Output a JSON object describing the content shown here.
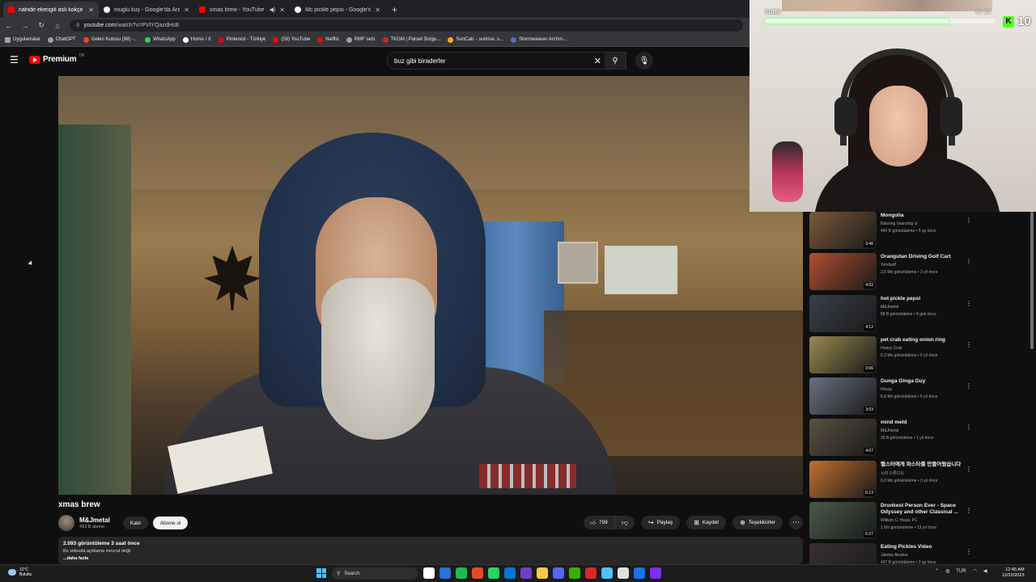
{
  "browser": {
    "tabs": [
      {
        "title": "nahide ekengili asli kokçe - You",
        "favicon": "youtube",
        "active": true
      },
      {
        "title": "muglu kuş - Google'da Ara",
        "favicon": "google",
        "active": false
      },
      {
        "title": "xmas brew - YouTube",
        "favicon": "youtube",
        "active": false
      },
      {
        "title": "Mc pickle pepsi - Google'da Ar",
        "favicon": "google",
        "active": false
      }
    ],
    "url_host": "youtube.com",
    "url_path": "/watch?v=PVtYQazdHsB",
    "bookmarks": [
      "Uygulamalar",
      "ChatGPT",
      "Gelen Kutusu (98) -...",
      "WhatsApp",
      "Home / X",
      "Pinterest - Türkiye",
      "(58) YouTube",
      "Netflix",
      "RMF sets",
      "TKGM | Parsel Sorgu...",
      "SunCalc - sunrise, s...",
      "Stormweaver Archm..."
    ]
  },
  "youtube": {
    "logo_text": "Premium",
    "logo_suffix": "TR",
    "search_query": "buz gibi biraderler"
  },
  "video": {
    "title": "xmas brew",
    "channel": "M&Jmetal",
    "subscribers": "433 B abone",
    "join_label": "Katıl",
    "subscribe_label": "Abone ol",
    "likes": "799",
    "share_label": "Paylaş",
    "save_label": "Kaydet",
    "thanks_label": "Teşekkürler",
    "stats": "2.093 görüntüleme  3 saat önce",
    "description": "Bu videoda açıklama mevcut değil",
    "more_label": "...daha fazla"
  },
  "overlay": {
    "subs_label": "SUBS",
    "subs_progress": "8 / 10",
    "subs_fraction": 0.8,
    "kick_count": "10",
    "kick_color": "#53fc18"
  },
  "recommendations": [
    {
      "title": "Mongolia",
      "channel": "Batzorig Vaanchig ⊘",
      "meta": "440 B görüntüleme • 5 ay önce",
      "duration": "3:46",
      "color": "#7a5a3a"
    },
    {
      "title": "Orangutan Driving Golf Cart",
      "channel": "Tomfoolf",
      "meta": "2,6 Mn görüntüleme • 3 yıl önce",
      "duration": "4:02",
      "color": "#b05030"
    },
    {
      "title": "hot pickle pepsi",
      "channel": "M&Jmetal",
      "meta": "58 B görüntüleme • 8 gün önce",
      "duration": "4:12",
      "color": "#3a3f4a"
    },
    {
      "title": "pet crab eating onion ring",
      "channel": "Heavy Crab",
      "meta": "6,3 Mn görüntüleme • 9 yıl önce",
      "duration": "3:06",
      "color": "#9a8a50"
    },
    {
      "title": "Gunga Ginga Guy",
      "channel": "Nirwia",
      "meta": "6,9 Mn görüntüleme • 6 yıl önce",
      "duration": "3:03",
      "color": "#6a7080"
    },
    {
      "title": "mind meld",
      "channel": "M&Jmetal",
      "meta": "35 B görüntüleme • 1 yıl önce",
      "duration": "4:07",
      "color": "#5a5040"
    },
    {
      "title": "햄스터에게 파스타를 만들어줬습니다",
      "channel": "시리 스튜디오",
      "meta": "6,8 Mn görüntüleme • 3 yıl önce",
      "duration": "6:13",
      "color": "#c07030"
    },
    {
      "title": "Drunkest Person Ever - Space Odyssey and other Classical ...",
      "channel": "William C. Head, PC",
      "meta": "1 Mn görüntüleme • 13 yıl önce",
      "duration": "5:27",
      "color": "#4a5a4a"
    },
    {
      "title": "Eating Pickles Video",
      "channel": "Jakeka Akakka",
      "meta": "407 B görüntüleme • 3 ay önce",
      "duration": "",
      "color": "#3a3030"
    }
  ],
  "taskbar": {
    "weather_temp": "12°C",
    "weather_desc": "Bulutlu",
    "search_label": "Search",
    "language": "TUR",
    "time": "12:45 AM",
    "date": "12/22/2023",
    "apps": [
      "#ffffff",
      "#2a6fdb",
      "#1db954",
      "#e34c26",
      "#25d366",
      "#0078d4",
      "#6e40c9",
      "#f7c948",
      "#5865f2",
      "#38b000",
      "#d62828",
      "#4cc2ff",
      "#e0e0e0",
      "#1a73e8",
      "#7b2ff7"
    ]
  }
}
